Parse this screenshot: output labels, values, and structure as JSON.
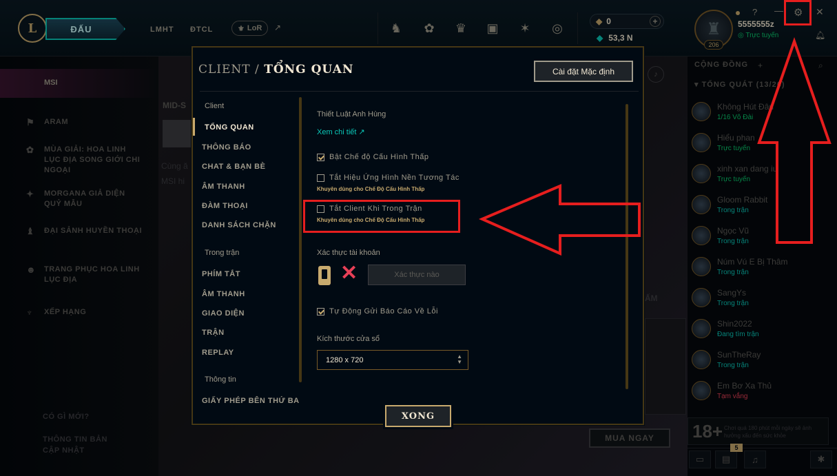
{
  "topbar": {
    "logo_text": "L",
    "play_label": "ĐẤU",
    "nav_lmht": "LMHT",
    "nav_dtcl": "ĐTCL",
    "nav_lor": "LoR",
    "nav_icons": [
      "champion-icon",
      "loot-icon",
      "clash-icon",
      "collection-icon",
      "tft-icon",
      "store-icon"
    ],
    "rp_value": "0",
    "be_value": "53,3 N",
    "summoner_name": "5555555z",
    "summoner_status": "Trực tuyến",
    "level": "206",
    "help_glyph": "?",
    "minimize_glyph": "—",
    "settings_glyph": "⚙",
    "close_glyph": "✕"
  },
  "left_sidebar": {
    "msi_label": "MSI",
    "items": [
      {
        "icon": "aram-icon",
        "label": "ARAM"
      },
      {
        "icon": "season-icon",
        "label": "MÙA GIẢI: HOA LINH LỤC ĐỊA SONG GIỚI CHI NGOẠI"
      },
      {
        "icon": "skin-icon",
        "label": "MORGANA GIẢ DIỆN QUỶ MẪU"
      },
      {
        "icon": "hall-icon",
        "label": "ĐẠI SẢNH HUYỀN THOẠI"
      },
      {
        "icon": "costume-icon",
        "label": "TRANG PHỤC HOA LINH LỤC ĐỊA"
      },
      {
        "icon": "rank-icon",
        "label": "XẾP HẠNG"
      }
    ],
    "whats_new": "CÓ GÌ MỚI?",
    "patch_notes": "THÔNG TIN BẢN CẬP NHẬT"
  },
  "background": {
    "mid_label": "MID-S",
    "cung_text": "Cùng ă",
    "msi_hint": "MSI hi",
    "am_text": "ẤM",
    "buy_label": "MUA NGAY"
  },
  "social": {
    "header": "CỘNG ĐỒNG",
    "group": "TỔNG QUÁT (13/26)",
    "friends": [
      {
        "name": "Không Hút Đâu",
        "status": "1/16 Vô Đài",
        "color": "#0acb6e"
      },
      {
        "name": "Hiểu phan",
        "status": "Trực tuyến",
        "color": "#0acb6e"
      },
      {
        "name": "xinh xan dang iu",
        "status": "Trực tuyến",
        "color": "#0acb6e"
      },
      {
        "name": "Gloom Rabbit",
        "status": "Trong trận",
        "color": "#0ac8b9"
      },
      {
        "name": "Ngọc Vũ",
        "status": "Trong trận",
        "color": "#0ac8b9"
      },
      {
        "name": "Núm Vú E Bị Thâm",
        "status": "Trong trận",
        "color": "#0ac8b9"
      },
      {
        "name": "SangYs",
        "status": "Trong trận",
        "color": "#0ac8b9"
      },
      {
        "name": "Shin2022",
        "status": "Đang tìm trận",
        "color": "#0ac8b9"
      },
      {
        "name": "SunTheRay",
        "status": "Trong trận",
        "color": "#0ac8b9"
      },
      {
        "name": "Em Bơ Xa Thủ",
        "status": "Tạm vắng",
        "color": "#e84057"
      }
    ],
    "age_rating": "18+",
    "age_warning": "Chơi quá 180 phút mỗi ngày sẽ ảnh hưởng xấu đến sức khỏe",
    "notif_count": "5"
  },
  "modal": {
    "title_prefix": "CLIENT /",
    "title_main": "TỔNG QUAN",
    "reset_button": "Cài đặt Mặc định",
    "menu": {
      "cat_client": "Client",
      "client_items": [
        "TỔNG QUAN",
        "THÔNG BÁO",
        "CHAT & BẠN BÈ",
        "ÂM THANH",
        "ĐÀM THOẠI",
        "DANH SÁCH CHẶN"
      ],
      "cat_ingame": "Trong trận",
      "ingame_items": [
        "PHÍM TẮT",
        "ÂM THANH",
        "GIAO DIỆN",
        "TRẬN",
        "REPLAY"
      ],
      "cat_info": "Thông tin",
      "info_items": [
        "GIẤY PHÉP BÊN THỨ BA"
      ]
    },
    "content": {
      "hero_rules_label": "Thiết Luật Anh Hùng",
      "see_details": "Xem chi tiết ↗",
      "low_spec": "Bật Chế độ Cấu Hình Thấp",
      "low_spec_checked": true,
      "disable_bg_anim": "Tắt Hiệu Ứng Hình Nền Tương Tác",
      "disable_bg_anim_checked": false,
      "recommend_1": "Khuyên dùng cho Chế Độ Cấu Hình Thấp",
      "close_client": "Tắt Client Khi Trong Trận",
      "close_client_checked": false,
      "recommend_2": "Khuyên dùng cho Chế Độ Cấu Hình Thấp",
      "verify_label": "Xác thực tài khoản",
      "verify_button": "Xác thực nào",
      "auto_report": "Tự Động Gửi Báo Cáo Về Lỗi",
      "auto_report_checked": true,
      "window_size_label": "Kích thước cửa sổ",
      "window_size_value": "1280 x 720"
    },
    "done_button": "XONG"
  },
  "annotation_color": "#e61e1e"
}
